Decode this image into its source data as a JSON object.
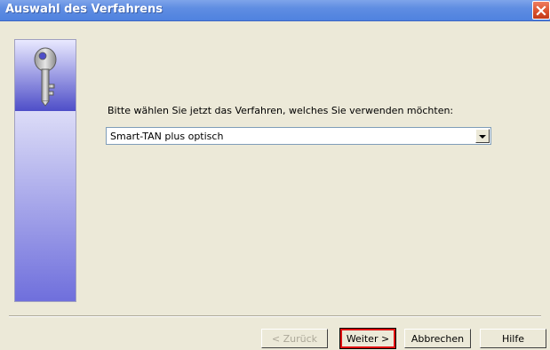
{
  "window": {
    "title": "Auswahl des Verfahrens",
    "close_icon": "close-icon"
  },
  "banner": {
    "icon": "key-icon"
  },
  "main": {
    "prompt": "Bitte wählen Sie jetzt das Verfahren, welches Sie verwenden möchten:",
    "selected_method": "Smart-TAN plus optisch",
    "dropdown_icon": "chevron-down-icon"
  },
  "buttons": {
    "back_label": "< Zurück",
    "next_label": "Weiter >",
    "cancel_label": "Abbrechen",
    "help_label": "Hilfe"
  },
  "colors": {
    "titlebar": "#5f8de2",
    "dialog_background": "#ece9d8",
    "highlight": "#e01010"
  }
}
